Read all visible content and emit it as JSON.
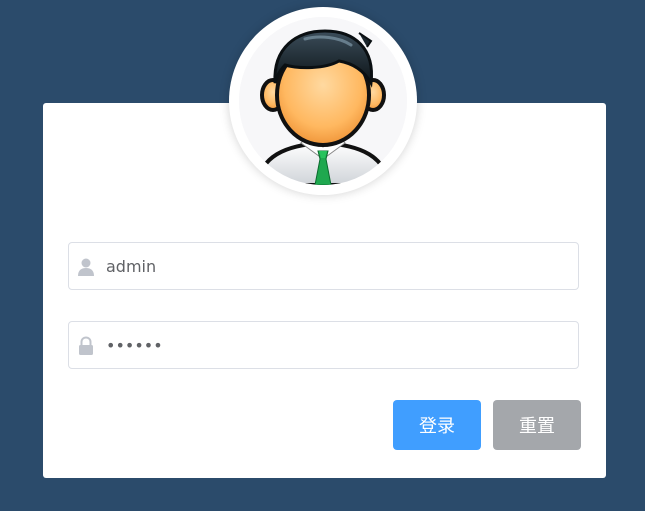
{
  "colors": {
    "background": "#2b4b6b",
    "primary": "#409eff",
    "info": "#a4a7ab",
    "card": "#ffffff"
  },
  "avatar": {
    "icon": "user-avatar-illustration"
  },
  "form": {
    "username": {
      "icon": "user-icon",
      "value": "admin"
    },
    "password": {
      "icon": "lock-icon",
      "value": "••••••"
    },
    "buttons": {
      "login_label": "登录",
      "reset_label": "重置"
    }
  }
}
